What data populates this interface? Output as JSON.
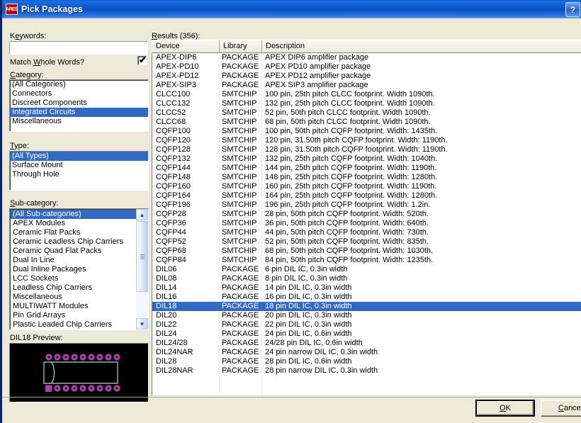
{
  "window": {
    "title": "Pick Packages",
    "icon": "ares-logo-icon",
    "icon_text": "ARES",
    "help_button": "?"
  },
  "left_panel": {
    "keywords_label": "Keywords:",
    "keywords_value": "",
    "keywords_placeholder": "",
    "match_whole_words_label": "Match Whole Words?",
    "match_whole_words_checked": "✔",
    "category_label": "Category:",
    "category_items": [
      "(All Categories)",
      "Connectors",
      "Discreet Components",
      "Integrated Circuits",
      "Miscellaneous"
    ],
    "category_selected": "Integrated Circuits",
    "type_label": "Type:",
    "type_items": [
      "(All Types)",
      "Surface Mount",
      "Through Hole"
    ],
    "type_selected": "(All Types)",
    "subcategory_label": "Sub-category:",
    "subcategory_items": [
      "(All Sub-categories)",
      "APEX Modules",
      "Ceramic Flat Packs",
      "Ceramic Leadless Chip Carriers",
      "Ceramic Quad Flat Packs",
      "Dual In Line",
      "Dual Inline Packages",
      "LCC Sockets",
      "Leadless Chip Carriers",
      "Miscellaneous",
      "MULTIWATT Modules",
      "Pin Grid Arrays",
      "Plastic Leaded Chip Carriers"
    ],
    "subcategory_selected": "(All Sub-categories)",
    "preview_label": "DIL18 Preview:",
    "preview_pads_top": 9,
    "preview_pads_bottom": 9,
    "preview_bg_color": "#000000",
    "preview_pad_color": "#b040b0",
    "preview_outline_color": "#a8d8d8"
  },
  "results": {
    "label": "Results (356):",
    "count": 356,
    "columns": [
      "Device",
      "Library",
      "Description"
    ],
    "selected_device": "DIL18",
    "rows": [
      {
        "device": "APEX-DIP6",
        "library": "PACKAGE",
        "description": "APEX DIP6 amplifier package"
      },
      {
        "device": "APEX-PD10",
        "library": "PACKAGE",
        "description": "APEX PD10 amplifier package"
      },
      {
        "device": "APEX-PD12",
        "library": "PACKAGE",
        "description": "APEX PD12 amplifier package"
      },
      {
        "device": "APEX-SIP3",
        "library": "PACKAGE",
        "description": "APEX SIP3 amplifier package"
      },
      {
        "device": "CLCC100",
        "library": "SMTCHIP",
        "description": "100 pin, 25th pitch CLCC footprint. Width 1090th."
      },
      {
        "device": "CLCC132",
        "library": "SMTCHIP",
        "description": "132 pin, 25th pitch CLCC footprint. Width 1090th."
      },
      {
        "device": "CLCC52",
        "library": "SMTCHIP",
        "description": "52 pin, 50th pitch CLCC footprint. Width 1090th."
      },
      {
        "device": "CLCC68",
        "library": "SMTCHIP",
        "description": "68 pin, 50th pitch CLCC footprint. Width 1090th."
      },
      {
        "device": "CQFP100",
        "library": "SMTCHIP",
        "description": "100 pin, 50th pitch CQFP footprint. Width: 1435th."
      },
      {
        "device": "CQFP120",
        "library": "SMTCHIP",
        "description": "120 pin, 31.50th pitch CQFP footprint. Width: 1190th."
      },
      {
        "device": "CQFP128",
        "library": "SMTCHIP",
        "description": "128 pin, 31.50th pitch CQFP footprint. Width: 1190th."
      },
      {
        "device": "CQFP132",
        "library": "SMTCHIP",
        "description": "132 pin, 25th pitch CQFP footprint. Width: 1040th."
      },
      {
        "device": "CQFP144",
        "library": "SMTCHIP",
        "description": "144 pin, 25th pitch CQFP footprint. Width: 1190th."
      },
      {
        "device": "CQFP148",
        "library": "SMTCHIP",
        "description": "148 pin, 25th pitch CQFP footprint. Width: 1280th."
      },
      {
        "device": "CQFP160",
        "library": "SMTCHIP",
        "description": "160 pin, 25th pitch CQFP footprint. Width: 1190th."
      },
      {
        "device": "CQFP164",
        "library": "SMTCHIP",
        "description": "164 pin, 25th pitch CQFP footprint. Width: 1280th."
      },
      {
        "device": "CQFP196",
        "library": "SMTCHIP",
        "description": "196 pin, 25th pitch CQFP footprint. Width: 1.2in."
      },
      {
        "device": "CQFP28",
        "library": "SMTCHIP",
        "description": "28 pin, 50th pitch CQFP footprint. Width: 520th."
      },
      {
        "device": "CQFP36",
        "library": "SMTCHIP",
        "description": "36 pin, 50th pitch CQFP footprint. Width: 640th."
      },
      {
        "device": "CQFP44",
        "library": "SMTCHIP",
        "description": "44 pin, 50th pitch CQFP footprint. Width: 730th."
      },
      {
        "device": "CQFP52",
        "library": "SMTCHIP",
        "description": "52 pin, 50th pitch CQFP footprint. Width: 835th."
      },
      {
        "device": "CQFP68",
        "library": "SMTCHIP",
        "description": "68 pin, 50th pitch CQFP footprint. Width: 1030th."
      },
      {
        "device": "CQFP84",
        "library": "SMTCHIP",
        "description": "84 pin, 50th pitch CQFP footprint. Width: 1235th."
      },
      {
        "device": "DIL06",
        "library": "PACKAGE",
        "description": "6 pin DIL IC, 0.3in width"
      },
      {
        "device": "DIL08",
        "library": "PACKAGE",
        "description": "8 pin DIL IC, 0.3in width"
      },
      {
        "device": "DIL14",
        "library": "PACKAGE",
        "description": "14 pin DIL IC, 0.3in width"
      },
      {
        "device": "DIL16",
        "library": "PACKAGE",
        "description": "16 pin DIL IC, 0.3in width"
      },
      {
        "device": "DIL18",
        "library": "PACKAGE",
        "description": "18 pin DIL IC, 0.3in width"
      },
      {
        "device": "DIL20",
        "library": "PACKAGE",
        "description": "20 pin DIL IC, 0.3in width"
      },
      {
        "device": "DIL22",
        "library": "PACKAGE",
        "description": "22 pin DIL IC, 0.3in width"
      },
      {
        "device": "DIL24",
        "library": "PACKAGE",
        "description": "24 pin DIL IC, 0.6in width"
      },
      {
        "device": "DIL24/28",
        "library": "PACKAGE",
        "description": "24/28 pin DIL IC, 0.6in width"
      },
      {
        "device": "DIL24NAR",
        "library": "PACKAGE",
        "description": "24 pin narrow DIL IC, 0.3in width"
      },
      {
        "device": "DIL28",
        "library": "PACKAGE",
        "description": "28 pin DIL IC, 0.6in width"
      },
      {
        "device": "DIL28NAR",
        "library": "PACKAGE",
        "description": "28 pin narrow DIL IC, 0.3in width"
      }
    ]
  },
  "footer": {
    "ok_label": "OK",
    "cancel_label": "Cancel"
  },
  "colors": {
    "selection_blue": "#316ac5",
    "titlebar_blue": "#0a50c8",
    "face": "#ece9d8"
  }
}
